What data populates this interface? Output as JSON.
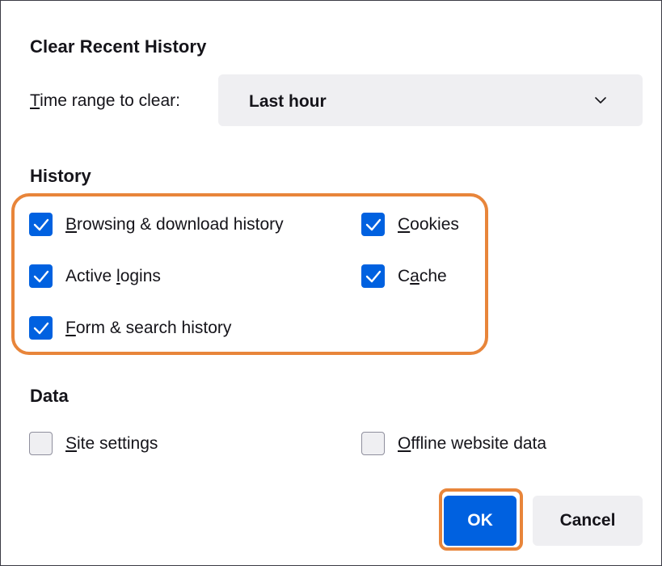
{
  "dialog": {
    "title": "Clear Recent History",
    "time_range": {
      "label_accel": "T",
      "label_rest": "ime range to clear:",
      "selected": "Last hour"
    },
    "history": {
      "heading": "History",
      "items": [
        {
          "accel": "B",
          "rest": "rowsing & download history",
          "checked": true
        },
        {
          "pre": "Active ",
          "accel": "l",
          "rest": "ogins",
          "checked": true
        },
        {
          "accel": "F",
          "rest": "orm & search history",
          "checked": true
        },
        {
          "accel": "C",
          "rest": "ookies",
          "checked": true
        },
        {
          "pre": "C",
          "accel": "a",
          "rest": "che",
          "checked": true
        }
      ]
    },
    "data": {
      "heading": "Data",
      "items": [
        {
          "accel": "S",
          "rest": "ite settings",
          "checked": false
        },
        {
          "accel": "O",
          "rest": "ffline website data",
          "checked": false
        }
      ]
    },
    "buttons": {
      "ok": "OK",
      "cancel": "Cancel"
    }
  },
  "colors": {
    "accent": "#0061e0",
    "highlight": "#e8853a"
  }
}
